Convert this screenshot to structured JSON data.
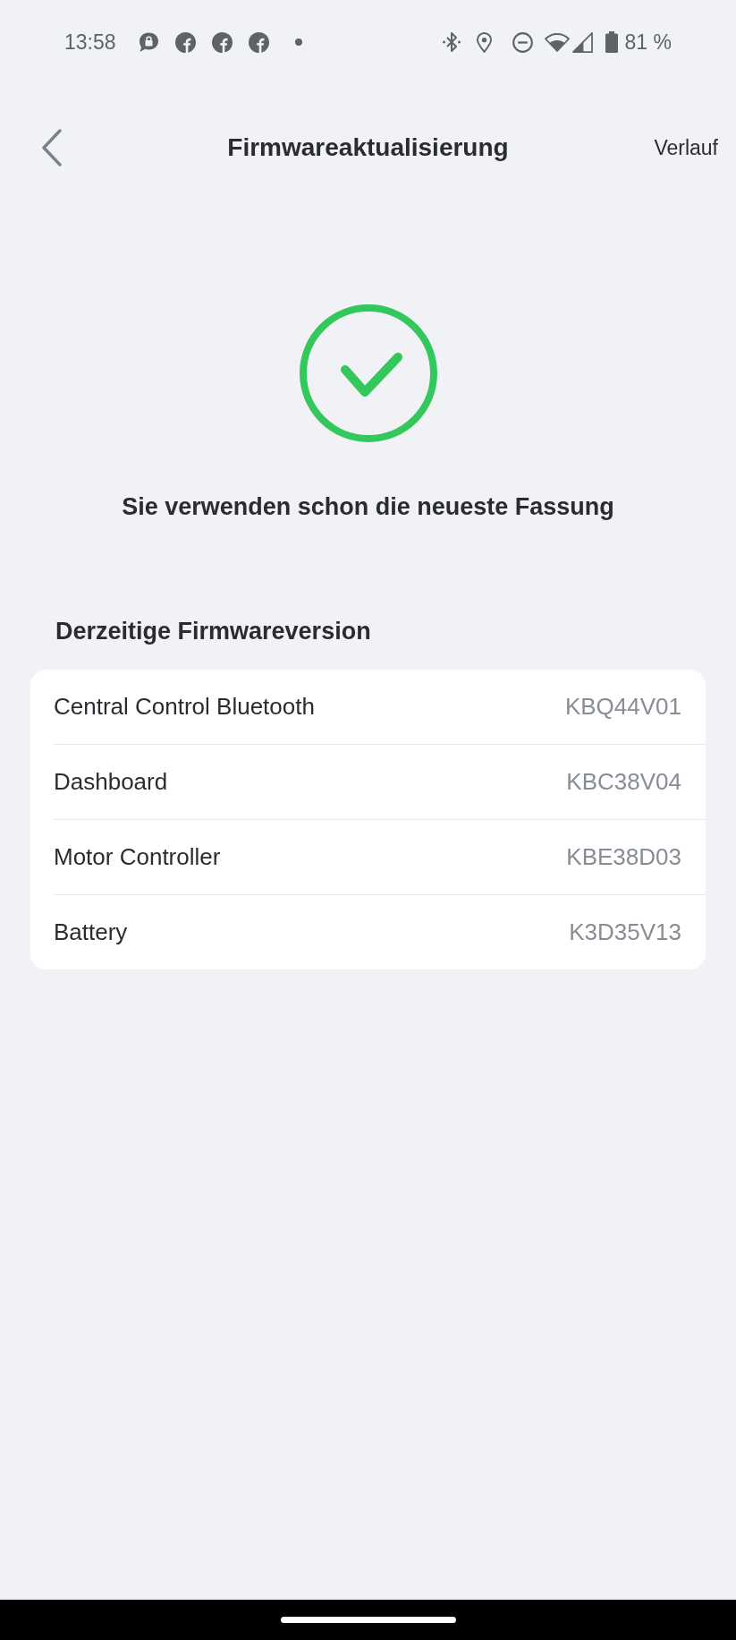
{
  "status_bar": {
    "time": "13:58",
    "battery": "81 %"
  },
  "header": {
    "title": "Firmwareaktualisierung",
    "action": "Verlauf"
  },
  "status": {
    "up_to_date": true,
    "message": "Sie verwenden schon die neueste Fassung"
  },
  "firmware": {
    "heading": "Derzeitige Firmwareversion",
    "rows": [
      {
        "name": "Central Control Bluetooth",
        "version": "KBQ44V01"
      },
      {
        "name": "Dashboard",
        "version": "KBC38V04"
      },
      {
        "name": "Motor Controller",
        "version": "KBE38D03"
      },
      {
        "name": "Battery",
        "version": "K3D35V13"
      }
    ]
  }
}
